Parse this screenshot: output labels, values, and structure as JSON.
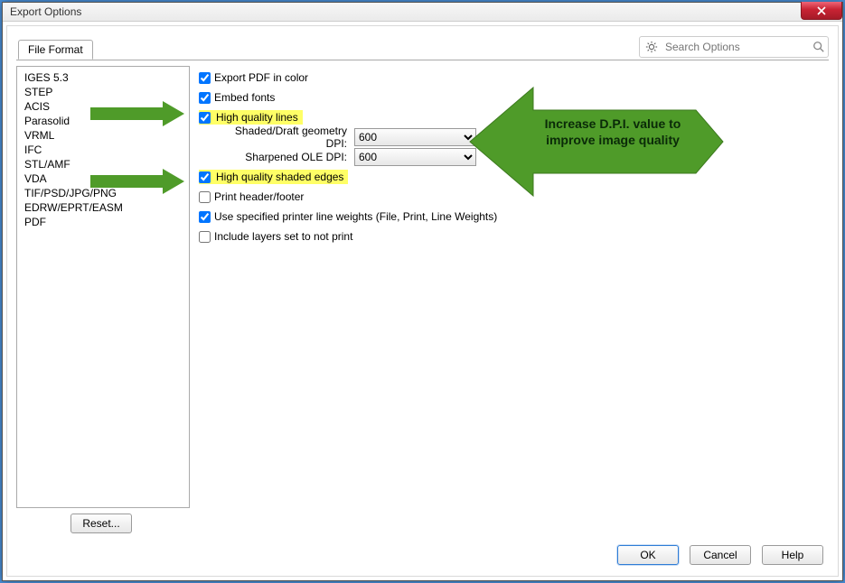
{
  "window": {
    "title": "Export Options"
  },
  "tabs": {
    "file_format": "File Format"
  },
  "search": {
    "placeholder": "Search Options"
  },
  "sidebar": {
    "items": [
      "IGES 5.3",
      "STEP",
      "ACIS",
      "Parasolid",
      "VRML",
      "IFC",
      "STL/AMF",
      "VDA",
      "TIF/PSD/JPG/PNG",
      "EDRW/EPRT/EASM",
      "PDF"
    ]
  },
  "options": {
    "export_pdf_in_color": "Export PDF in color",
    "embed_fonts": "Embed fonts",
    "high_quality_lines": "High quality lines",
    "shaded_draft_dpi_label": "Shaded/Draft geometry DPI:",
    "shaded_draft_dpi_value": "600",
    "sharpened_ole_dpi_label": "Sharpened OLE DPI:",
    "sharpened_ole_dpi_value": "600",
    "high_quality_shaded_edges": "High quality shaded edges",
    "print_header_footer": "Print header/footer",
    "use_specified_line_weights": "Use specified printer line weights (File, Print, Line Weights)",
    "include_layers_not_print": "Include layers set to not print"
  },
  "buttons": {
    "reset": "Reset...",
    "ok": "OK",
    "cancel": "Cancel",
    "help": "Help"
  },
  "annotation": {
    "callout": "Increase D.P.I. value to improve image quality"
  }
}
